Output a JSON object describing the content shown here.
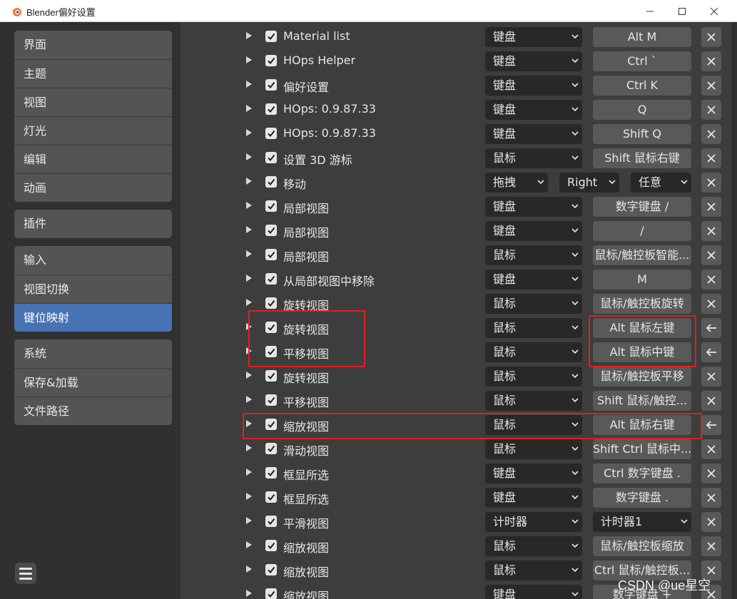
{
  "window": {
    "title": "Blender偏好设置"
  },
  "sidebar": {
    "groups": [
      [
        "界面",
        "主题",
        "视图",
        "灯光",
        "编辑",
        "动画"
      ],
      [
        "插件"
      ],
      [
        "输入",
        "视图切换",
        "键位映射"
      ],
      [
        "系统",
        "保存&加载",
        "文件路径"
      ]
    ],
    "active": "键位映射"
  },
  "rows": [
    {
      "name": "Material list",
      "type": "键盘",
      "key": "Alt M",
      "action": "remove"
    },
    {
      "name": "HOps Helper",
      "type": "键盘",
      "key": "Ctrl `",
      "action": "remove"
    },
    {
      "name": "偏好设置",
      "type": "键盘",
      "key": "Ctrl K",
      "action": "remove"
    },
    {
      "name": "HOps: 0.9.87.33",
      "type": "键盘",
      "key": "Q",
      "action": "remove"
    },
    {
      "name": "HOps: 0.9.87.33",
      "type": "键盘",
      "key": "Shift Q",
      "action": "remove"
    },
    {
      "name": "设置 3D 游标",
      "type": "鼠标",
      "key": "Shift 鼠标右键",
      "action": "remove"
    },
    {
      "name": "移动",
      "type": "拖拽",
      "direction": "Right",
      "modifier": "任意",
      "action": "remove"
    },
    {
      "name": "局部视图",
      "type": "键盘",
      "key": "数字键盘 /",
      "action": "remove"
    },
    {
      "name": "局部视图",
      "type": "键盘",
      "key": "/",
      "action": "remove"
    },
    {
      "name": "局部视图",
      "type": "鼠标",
      "key": "鼠标/触控板智能...",
      "action": "remove"
    },
    {
      "name": "从局部视图中移除",
      "type": "键盘",
      "key": "M",
      "action": "remove"
    },
    {
      "name": "旋转视图",
      "type": "鼠标",
      "key": "鼠标/触控板旋转",
      "action": "remove"
    },
    {
      "name": "旋转视图",
      "type": "鼠标",
      "key": "Alt 鼠标左键",
      "action": "restore"
    },
    {
      "name": "平移视图",
      "type": "鼠标",
      "key": "Alt 鼠标中键",
      "action": "restore"
    },
    {
      "name": "旋转视图",
      "type": "鼠标",
      "key": "鼠标/触控板平移",
      "action": "remove"
    },
    {
      "name": "平移视图",
      "type": "鼠标",
      "key": "Shift 鼠标/触控...",
      "action": "remove"
    },
    {
      "name": "缩放视图",
      "type": "鼠标",
      "key": "Alt 鼠标右键",
      "action": "restore"
    },
    {
      "name": "滑动视图",
      "type": "鼠标",
      "key": "Shift Ctrl 鼠标中...",
      "action": "remove"
    },
    {
      "name": "框显所选",
      "type": "键盘",
      "key": "Ctrl 数字键盘 .",
      "action": "remove"
    },
    {
      "name": "框显所选",
      "type": "键盘",
      "key": "数字键盘 .",
      "action": "remove"
    },
    {
      "name": "平滑视图",
      "type": "计时器",
      "key": "计时器1",
      "key_dropdown": true,
      "action": "remove"
    },
    {
      "name": "缩放视图",
      "type": "鼠标",
      "key": "鼠标/触控板缩放",
      "action": "remove"
    },
    {
      "name": "缩放视图",
      "type": "鼠标",
      "key": "Ctrl 鼠标/触控板...",
      "action": "remove"
    },
    {
      "name": "缩放视图",
      "type": "键盘",
      "key": "数字键盘 +",
      "action": "remove"
    }
  ],
  "watermark": "CSDN @ue星空",
  "colors": {
    "accent": "#4772b3",
    "annotation": "#e02020"
  }
}
